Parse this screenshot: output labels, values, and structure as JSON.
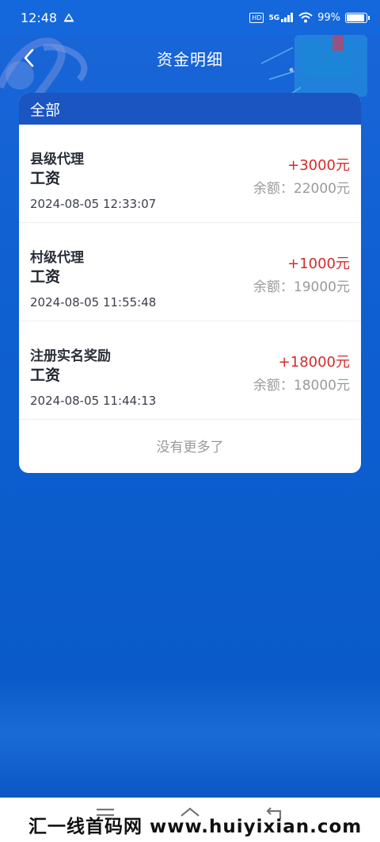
{
  "status_bar": {
    "time": "12:48",
    "network_badge": "HD",
    "network_type": "5G",
    "battery_percent": "99%"
  },
  "nav": {
    "title": "资金明细"
  },
  "card": {
    "tab_label": "全部",
    "records": [
      {
        "type": "县级代理",
        "category": "工资",
        "time": "2024-08-05 12:33:07",
        "amount": "+3000元",
        "balance": "余额：22000元"
      },
      {
        "type": "村级代理",
        "category": "工资",
        "time": "2024-08-05 11:55:48",
        "amount": "+1000元",
        "balance": "余额：19000元"
      },
      {
        "type": "注册实名奖励",
        "category": "工资",
        "time": "2024-08-05 11:44:13",
        "amount": "+18000元",
        "balance": "余额：18000元"
      }
    ],
    "end_note": "没有更多了"
  },
  "watermark": "汇一线首码网 www.huiyixian.com",
  "colors": {
    "amount": "#d42b2b",
    "header": "#1a55c2",
    "background": "#0e5fd0"
  }
}
